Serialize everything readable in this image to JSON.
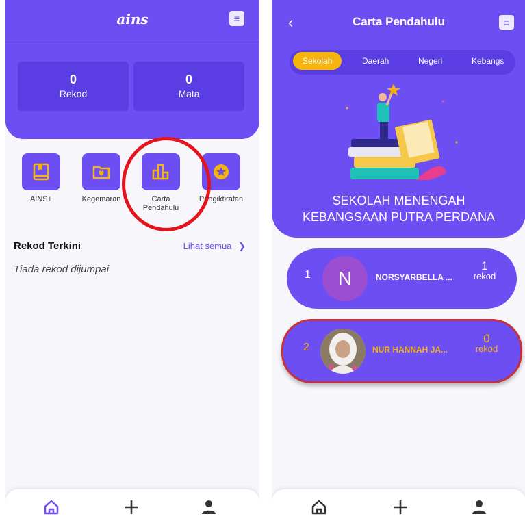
{
  "left": {
    "logo": "ains",
    "stats": [
      {
        "value": "0",
        "label": "Rekod"
      },
      {
        "value": "0",
        "label": "Mata"
      }
    ],
    "menu": [
      {
        "label": "AINS+"
      },
      {
        "label": "Kegemaran"
      },
      {
        "label": "Carta\nPendahulu"
      },
      {
        "label": "Pengiktirafan"
      }
    ],
    "recent_title": "Rekod Terkini",
    "see_all": "Lihat semua",
    "empty_text": "Tiada rekod dijumpai"
  },
  "right": {
    "title": "Carta Pendahulu",
    "tabs": [
      "Sekolah",
      "Daerah",
      "Negeri",
      "Kebangs"
    ],
    "school_line1": "SEKOLAH MENENGAH",
    "school_line2": "KEBANGSAAN PUTRA PERDANA",
    "ranks": [
      {
        "pos": "1",
        "initial": "N",
        "name": "NORSYARBELLA ...",
        "count": "1",
        "unit": "rekod"
      },
      {
        "pos": "2",
        "initial": "",
        "name": "NUR HANNAH JA...",
        "count": "0",
        "unit": "rekod"
      }
    ]
  },
  "colors": {
    "primary": "#6c4ef2",
    "accent": "#f6b40e",
    "highlight": "#e3141d"
  },
  "icons": {
    "menu": "hamburger-icon",
    "back": "chevron-left-icon",
    "nav": [
      "home-icon",
      "plus-icon",
      "user-icon"
    ]
  }
}
